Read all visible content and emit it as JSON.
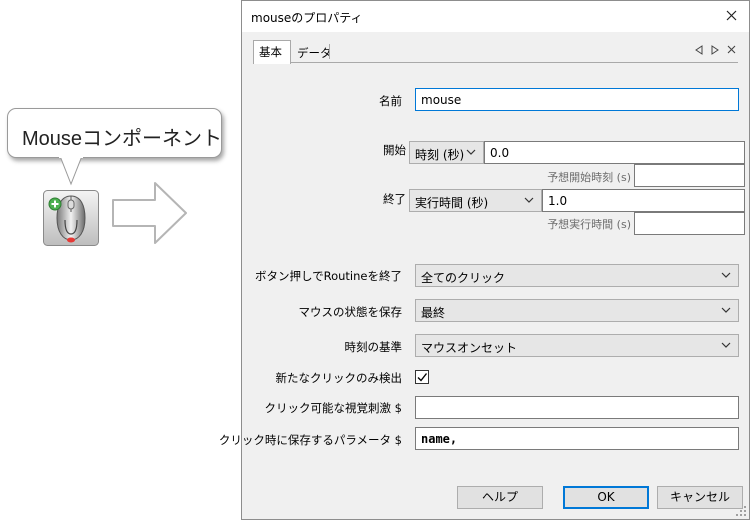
{
  "callout": {
    "text": "Mouseコンポーネント"
  },
  "dialog": {
    "title": "mouseのプロパティ",
    "tabs": [
      "基本",
      "データ"
    ],
    "fields": {
      "name": {
        "label": "名前",
        "value": "mouse"
      },
      "start": {
        "label": "開始",
        "type": "時刻 (秒)",
        "value": "0.0",
        "expected_label": "予想開始時刻 (s)",
        "expected_value": ""
      },
      "stop": {
        "label": "終了",
        "type": "実行時間 (秒)",
        "value": "1.0",
        "expected_label": "予想実行時間 (s)",
        "expected_value": ""
      },
      "force_end": {
        "label": "ボタン押しでRoutineを終了",
        "value": "全てのクリック"
      },
      "save_state": {
        "label": "マウスの状態を保存",
        "value": "最終"
      },
      "time_rel": {
        "label": "時刻の基準",
        "value": "マウスオンセット"
      },
      "new_clicks": {
        "label": "新たなクリックのみ検出",
        "checked": true
      },
      "clickable": {
        "label": "クリック可能な視覚刺激 $",
        "value": ""
      },
      "save_params": {
        "label": "クリック時に保存するパラメータ $",
        "value": "name,"
      }
    },
    "buttons": {
      "help": "ヘルプ",
      "ok": "OK",
      "cancel": "キャンセル"
    }
  },
  "icons": {
    "close": "close-icon",
    "tab_prev": "triangle-left-icon",
    "tab_next": "triangle-right-icon",
    "tab_close": "close-icon",
    "dropdown": "chevron-down-icon",
    "check": "checkmark-icon",
    "component": "mouse-component-icon",
    "arrow": "right-arrow-icon"
  },
  "colors": {
    "focus_border": "#0078d7",
    "dialog_bg": "#f0f0f0"
  }
}
